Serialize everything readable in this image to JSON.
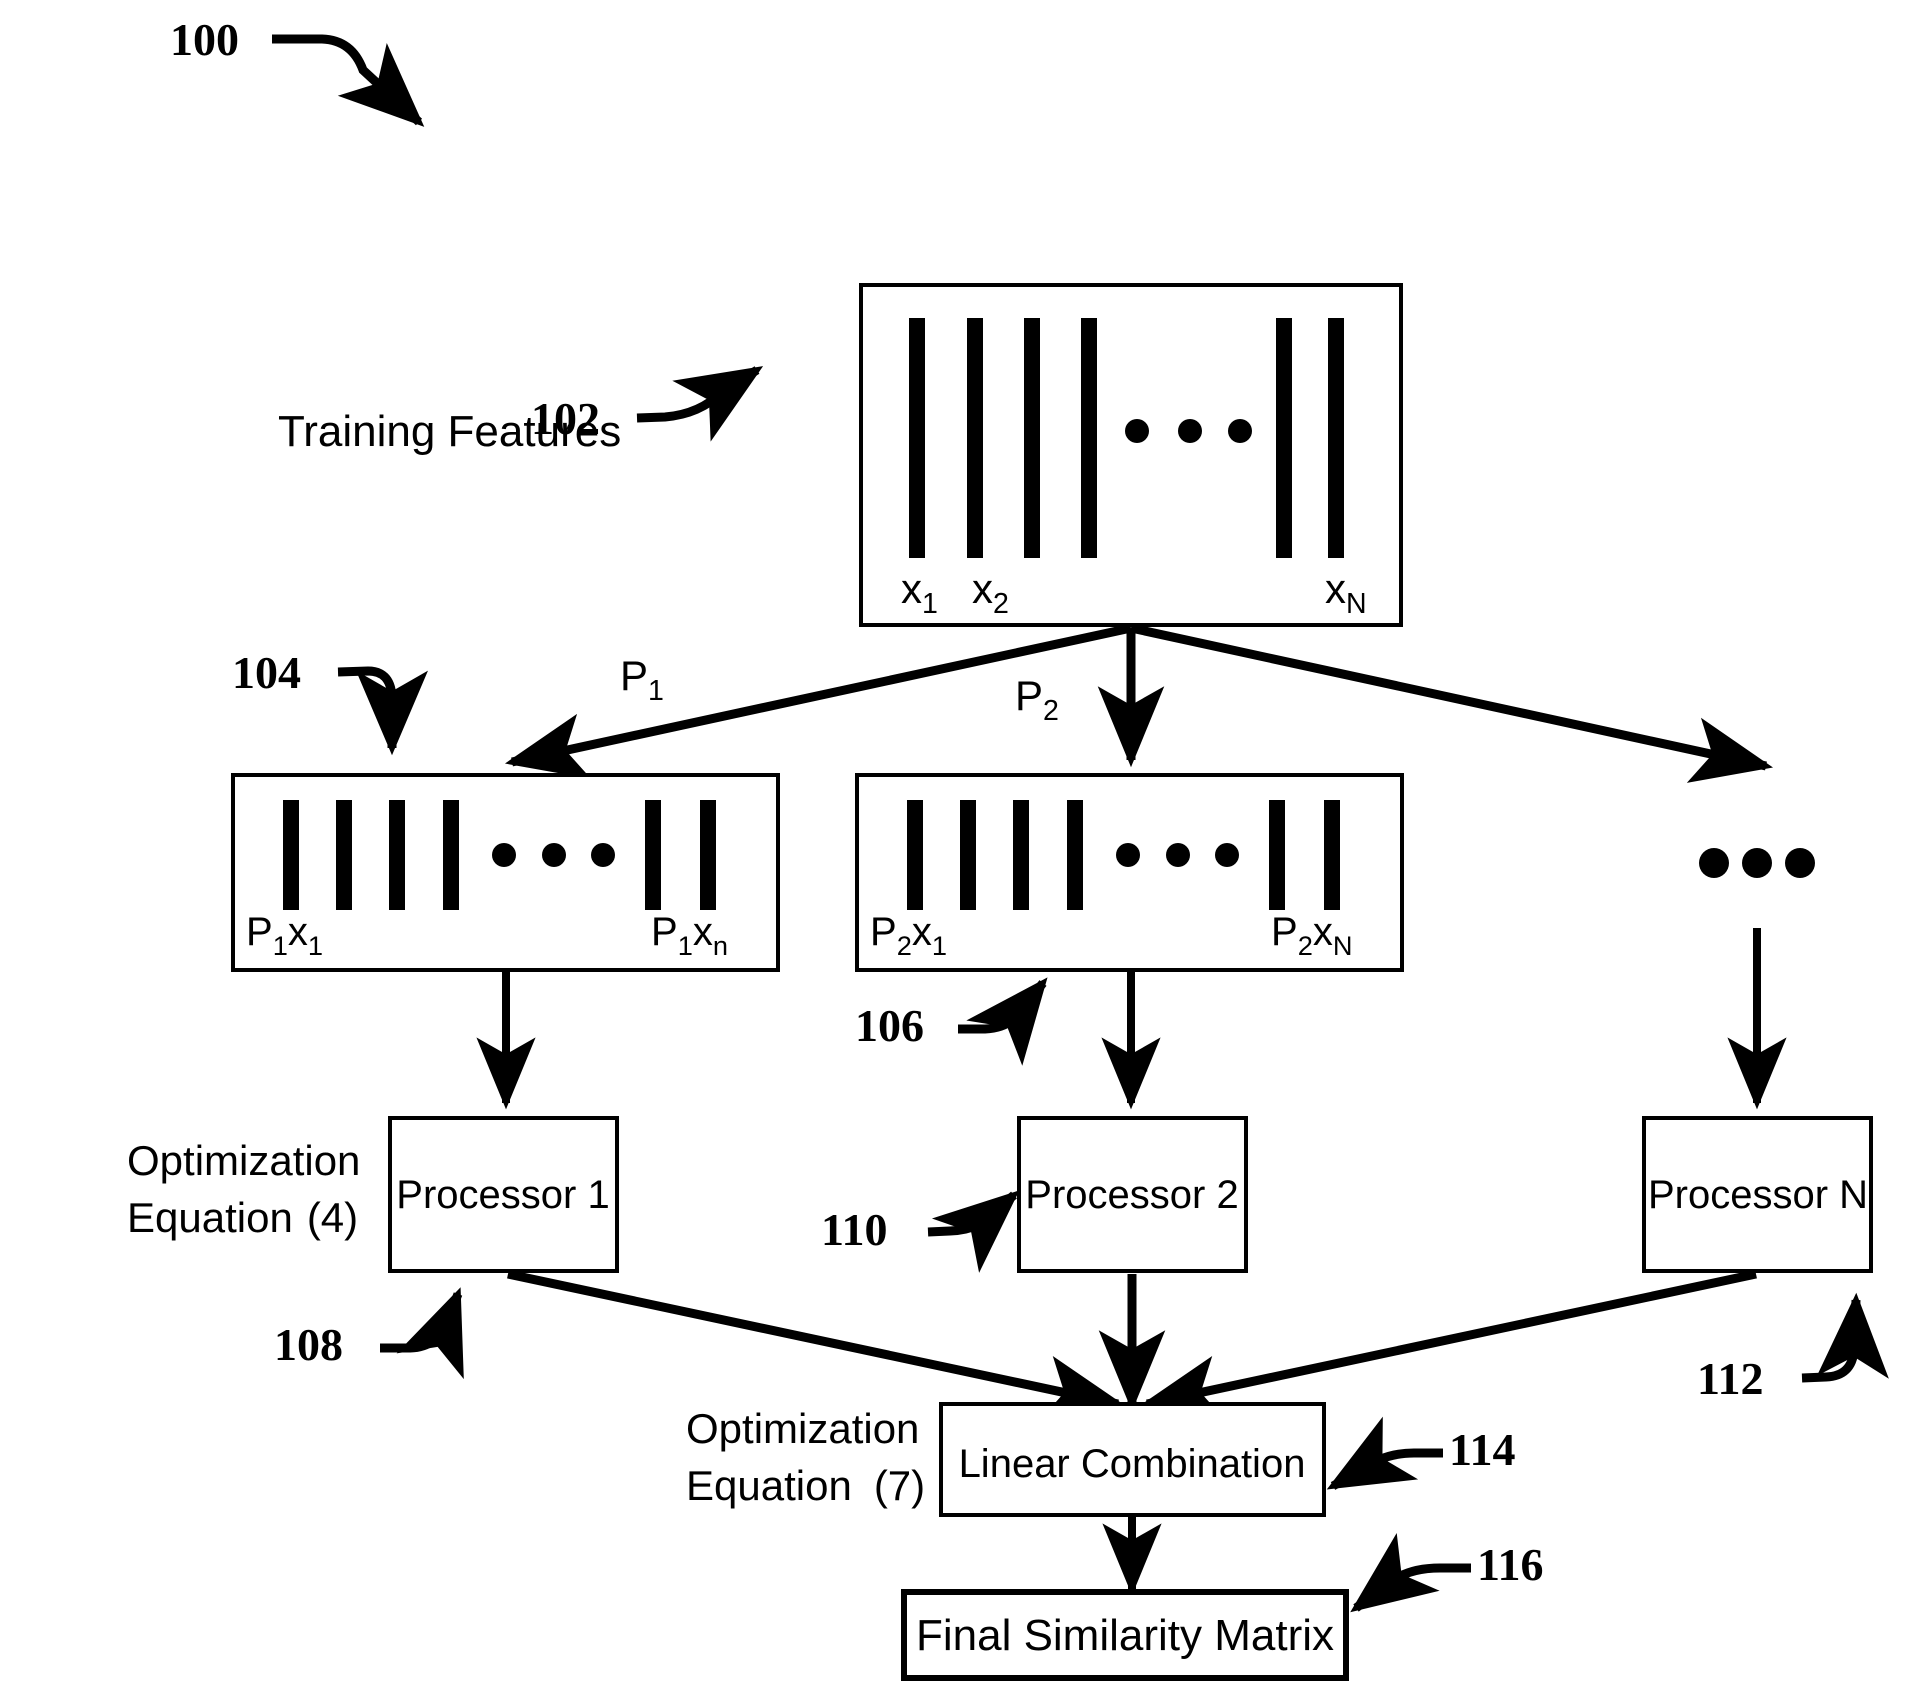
{
  "figure": {
    "number": "100",
    "title_label": "Training Features"
  },
  "refs": {
    "r100": "100",
    "r102": "102",
    "r104": "104",
    "r106": "106",
    "r108": "108",
    "r110": "110",
    "r112": "112",
    "r114": "114",
    "r116": "116"
  },
  "training_features_box": {
    "ref": "102",
    "caption": "Training Features",
    "column_labels": [
      {
        "base": "x",
        "sub": "1"
      },
      {
        "base": "x",
        "sub": "2"
      },
      {
        "base": "x",
        "sub": "N"
      }
    ],
    "bar_count_left": 4,
    "bar_count_right": 2,
    "ellipsis_dots": 3
  },
  "projection_edges": [
    {
      "label_base": "P",
      "label_sub": "1"
    },
    {
      "label_base": "P",
      "label_sub": "2"
    }
  ],
  "projected_boxes": [
    {
      "ref": "104",
      "left_label": {
        "base": "P",
        "sub1": "1",
        "var": "x",
        "sub2": "1"
      },
      "right_label": {
        "base": "P",
        "sub1": "1",
        "var": "x",
        "sub2": "n"
      },
      "bar_count_left": 4,
      "bar_count_right": 2,
      "ellipsis_dots": 3
    },
    {
      "ref": "106",
      "left_label": {
        "base": "P",
        "sub1": "2",
        "var": "x",
        "sub2": "1"
      },
      "right_label": {
        "base": "P",
        "sub1": "2",
        "var": "x",
        "sub2": "N"
      },
      "bar_count_left": 4,
      "bar_count_right": 2,
      "ellipsis_dots": 3
    },
    {
      "ref": null,
      "is_ellipsis_only": true,
      "ellipsis_dots": 3
    }
  ],
  "equation_notes": [
    {
      "line1": "Optimization",
      "line2": "Equation",
      "number": "(4)"
    },
    {
      "line1": "Optimization",
      "line2": "Equation",
      "number": "(7)"
    }
  ],
  "processors": [
    {
      "label": "Processor 1",
      "ref": "108"
    },
    {
      "label": "Processor 2",
      "ref": "110"
    },
    {
      "label": "Processor N",
      "ref": "112"
    }
  ],
  "combiner": {
    "label": "Linear Combination",
    "ref": "114"
  },
  "output": {
    "label": "Final Similarity Matrix",
    "ref": "116"
  },
  "colors": {
    "stroke": "#000000",
    "fill": "#ffffff"
  }
}
